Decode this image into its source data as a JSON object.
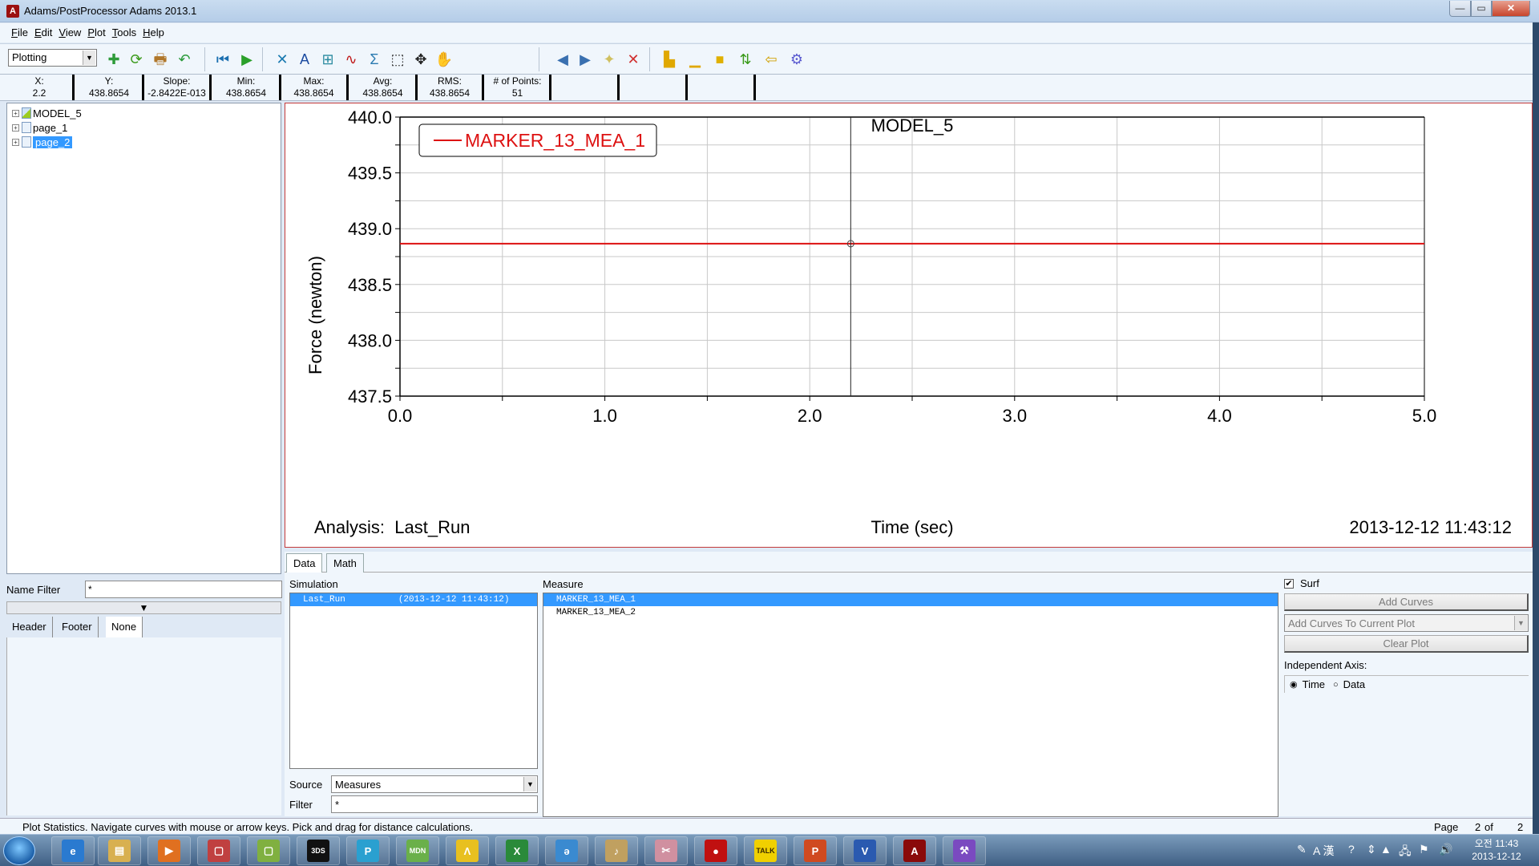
{
  "window": {
    "title": "Adams/PostProcessor Adams 2013.1",
    "app_icon": "A",
    "controls": {
      "minimize": "—",
      "maximize": "▭",
      "close": "✕"
    }
  },
  "menubar": {
    "items": [
      {
        "label": "File",
        "accel": "F",
        "rest": "ile"
      },
      {
        "label": "Edit",
        "accel": "E",
        "rest": "dit"
      },
      {
        "label": "View",
        "accel": "V",
        "rest": "iew"
      },
      {
        "label": "Plot",
        "accel": "P",
        "rest": "lot"
      },
      {
        "label": "Tools",
        "accel": "T",
        "rest": "ools"
      },
      {
        "label": "Help",
        "accel": "H",
        "rest": "elp"
      }
    ]
  },
  "toolbar": {
    "mode": "Plotting",
    "icons": [
      {
        "name": "new-page-icon",
        "glyph": "✚",
        "color": "#2e9b3a"
      },
      {
        "name": "reload-icon",
        "glyph": "⟳",
        "color": "#3a9a1a"
      },
      {
        "name": "print-icon",
        "glyph": "🖶",
        "color": "#b0772a"
      },
      {
        "name": "undo-icon",
        "glyph": "↶",
        "color": "#2a9a3a"
      },
      {
        "name": "rewind-icon",
        "glyph": "⏮",
        "color": "#1a6fb0"
      },
      {
        "name": "play-icon",
        "glyph": "▶",
        "color": "#2aa02a"
      },
      {
        "name": "tools-icon",
        "glyph": "✕",
        "color": "#1a7ab0"
      },
      {
        "name": "text-icon",
        "glyph": "A",
        "color": "#1a4aa0"
      },
      {
        "name": "table-icon",
        "glyph": "⊞",
        "color": "#2a8aa0"
      },
      {
        "name": "curve-icon",
        "glyph": "∿",
        "color": "#c01a1a"
      },
      {
        "name": "sigma-icon",
        "glyph": "Σ",
        "color": "#2a7ab0"
      },
      {
        "name": "zoom-box-icon",
        "glyph": "⬚",
        "color": "#222"
      },
      {
        "name": "fit-icon",
        "glyph": "✥",
        "color": "#222"
      },
      {
        "name": "pan-hand-icon",
        "glyph": "✋",
        "color": "#d0a060"
      },
      {
        "name": "prev-page-icon",
        "glyph": "◀",
        "color": "#3a70b0"
      },
      {
        "name": "next-page-icon",
        "glyph": "▶",
        "color": "#3a70b0"
      },
      {
        "name": "new-blank-page-icon",
        "glyph": "✦",
        "color": "#d0c060"
      },
      {
        "name": "delete-page-icon",
        "glyph": "✕",
        "color": "#d03030"
      },
      {
        "name": "layout-left-icon",
        "glyph": "▙",
        "color": "#e0a800"
      },
      {
        "name": "layout-bottom-icon",
        "glyph": "▁",
        "color": "#e0a800"
      },
      {
        "name": "color-fill-icon",
        "glyph": "■",
        "color": "#e0b000"
      },
      {
        "name": "swap-axes-icon",
        "glyph": "⇅",
        "color": "#3a9a1a"
      },
      {
        "name": "import-icon",
        "glyph": "⇦",
        "color": "#d0a000"
      },
      {
        "name": "settings-gear-icon",
        "glyph": "⚙",
        "color": "#5a5ad0"
      }
    ]
  },
  "stats": [
    {
      "label": "X:",
      "value": "2.2"
    },
    {
      "label": "Y:",
      "value": "438.8654"
    },
    {
      "label": "Slope:",
      "value": "-2.8422E-013"
    },
    {
      "label": "Min:",
      "value": "438.8654"
    },
    {
      "label": "Max:",
      "value": "438.8654"
    },
    {
      "label": "Avg:",
      "value": "438.8654"
    },
    {
      "label": "RMS:",
      "value": "438.8654"
    },
    {
      "label": "# of Points:",
      "value": "51"
    },
    {
      "label": "",
      "value": ""
    },
    {
      "label": "",
      "value": ""
    },
    {
      "label": "",
      "value": ""
    }
  ],
  "tree": [
    {
      "label": "MODEL_5",
      "selected": false
    },
    {
      "label": "page_1",
      "selected": false
    },
    {
      "label": "page_2",
      "selected": true
    }
  ],
  "left_panel": {
    "name_filter_label": "Name Filter",
    "name_filter_value": "*",
    "splitter_glyph": "▼",
    "tabs": [
      "Header",
      "Footer",
      "None"
    ]
  },
  "chart_data": {
    "type": "line",
    "title": "MODEL_5",
    "xlabel": "Time (sec)",
    "ylabel": "Force (newton)",
    "xlim": [
      0.0,
      5.0
    ],
    "ylim": [
      437.5,
      440.0
    ],
    "x_ticks": [
      "0.0",
      "1.0",
      "2.0",
      "3.0",
      "4.0",
      "5.0"
    ],
    "x_tick_values": [
      0,
      1,
      2,
      3,
      4,
      5
    ],
    "x_minor_step": 0.5,
    "y_ticks": [
      "440.0",
      "439.5",
      "439.0",
      "438.5",
      "438.0",
      "437.5"
    ],
    "y_tick_values": [
      440.0,
      439.5,
      439.0,
      438.5,
      438.0,
      437.5
    ],
    "y_minor_step": 0.25,
    "grid": true,
    "legend_position": "top-left",
    "series": [
      {
        "name": "MARKER_13_MEA_1",
        "color": "#dd1111",
        "x": [
          0.0,
          5.0
        ],
        "y": [
          438.8654,
          438.8654
        ]
      }
    ],
    "cursor": {
      "x": 2.2,
      "y": 438.8654
    },
    "footer_left": "Analysis:  Last_Run",
    "footer_right": "2013-12-12 11:43:12"
  },
  "data_tabs": [
    "Data",
    "Math"
  ],
  "simulation": {
    "label": "Simulation",
    "items": [
      {
        "name": "Last_Run",
        "time": "(2013-12-12 11:43:12)",
        "selected": true
      }
    ],
    "source_label": "Source",
    "source_value": "Measures",
    "filter_label": "Filter",
    "filter_value": "*"
  },
  "measure": {
    "label": "Measure",
    "items": [
      {
        "name": "MARKER_13_MEA_1",
        "selected": true
      },
      {
        "name": "MARKER_13_MEA_2",
        "selected": false
      }
    ]
  },
  "controls": {
    "surf_label": "Surf",
    "surf_checked": true,
    "add_curves": "Add Curves",
    "add_mode": "Add Curves To Current Plot",
    "clear_plot": "Clear Plot",
    "independent_axis_label": "Independent Axis:",
    "axis_options": [
      "Time",
      "Data"
    ],
    "axis_selected": "Time"
  },
  "statusbar": {
    "message": "Plot Statistics.  Navigate curves with mouse or arrow keys.  Pick and drag for distance calculations.",
    "page_label": "Page",
    "page_current": "2",
    "page_of": "of",
    "page_total": "2"
  },
  "taskbar": {
    "apps": [
      {
        "name": "ie-icon",
        "glyph": "e",
        "bg": "#2a7ad0"
      },
      {
        "name": "explorer-icon",
        "glyph": "▤",
        "bg": "#d8b050"
      },
      {
        "name": "media-player-icon",
        "glyph": "▶",
        "bg": "#e07020"
      },
      {
        "name": "app-window-icon",
        "glyph": "▢",
        "bg": "#c04040"
      },
      {
        "name": "app-window2-icon",
        "glyph": "▢",
        "bg": "#80b040"
      },
      {
        "name": "catia-icon",
        "glyph": "3DS",
        "bg": "#111"
      },
      {
        "name": "p-app-icon",
        "glyph": "P",
        "bg": "#2aa0d0"
      },
      {
        "name": "mdn-icon",
        "glyph": "MDN",
        "bg": "#6ab04a"
      },
      {
        "name": "alyac-icon",
        "glyph": "Λ",
        "bg": "#e8c020"
      },
      {
        "name": "excel-icon",
        "glyph": "X",
        "bg": "#2a8a3a"
      },
      {
        "name": "app-blue-icon",
        "glyph": "ə",
        "bg": "#3a8ad0"
      },
      {
        "name": "alarm-icon",
        "glyph": "♪",
        "bg": "#c0a060"
      },
      {
        "name": "snipping-icon",
        "glyph": "✂",
        "bg": "#d090a0"
      },
      {
        "name": "recorder-icon",
        "glyph": "●",
        "bg": "#c01010"
      },
      {
        "name": "kakaotalk-icon",
        "glyph": "TALK",
        "bg": "#f0d000"
      },
      {
        "name": "powerpoint-icon",
        "glyph": "P",
        "bg": "#d04a20"
      },
      {
        "name": "visio-icon",
        "glyph": "V",
        "bg": "#2a5ab0"
      },
      {
        "name": "adams-icon",
        "glyph": "A",
        "bg": "#8a0a0a"
      },
      {
        "name": "tools-app-icon",
        "glyph": "⚒",
        "bg": "#7a4ac0"
      }
    ],
    "tray": {
      "ime": "A 漢",
      "clock_time": "오전 11:43",
      "clock_date": "2013-12-12"
    }
  }
}
